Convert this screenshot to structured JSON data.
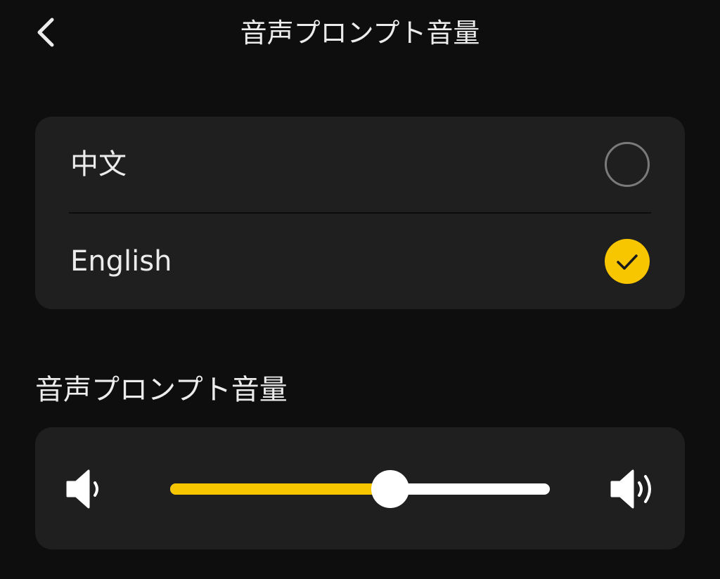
{
  "header": {
    "title": "音声プロンプト音量",
    "back_icon": "chevron-left-icon"
  },
  "language_options": [
    {
      "label": "中文",
      "selected": false
    },
    {
      "label": "English",
      "selected": true
    }
  ],
  "volume_section": {
    "title": "音声プロンプト音量",
    "level": 0.58,
    "low_icon": "volume-low-icon",
    "high_icon": "volume-high-icon"
  },
  "colors": {
    "background": "#0e0e0e",
    "card": "#1f1f1f",
    "accent": "#f7c600",
    "text": "#ececec",
    "radio_border": "#7a7a7a"
  }
}
